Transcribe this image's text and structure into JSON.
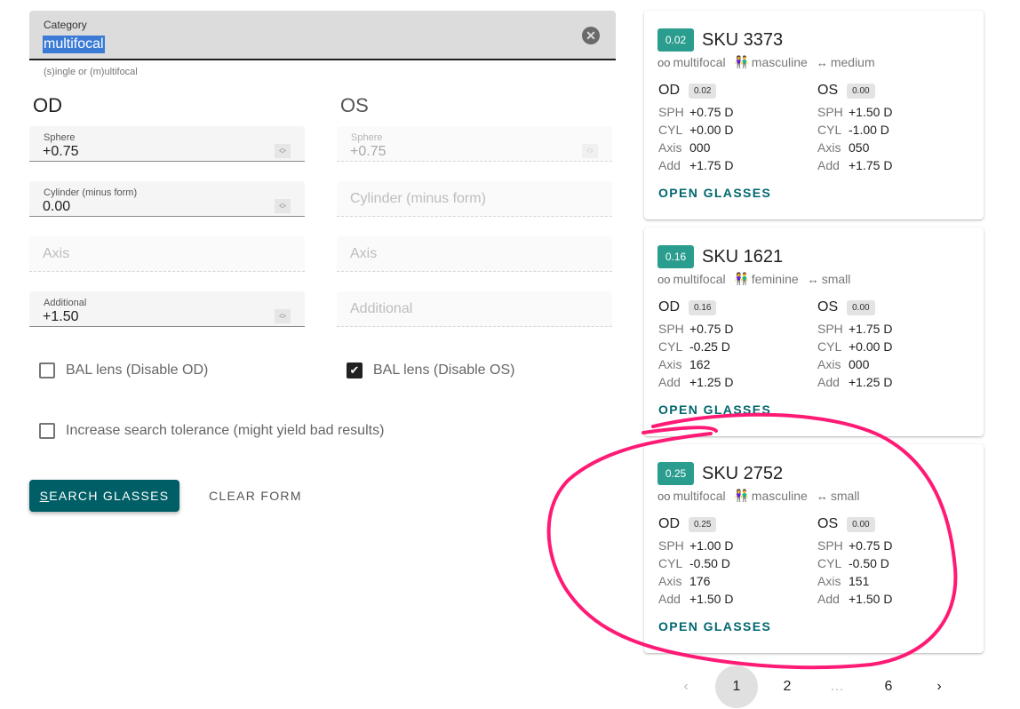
{
  "category": {
    "label": "Category",
    "value": "multifocal",
    "hint": "(s)ingle or (m)ultifocal",
    "clear_icon": "close-circle-icon"
  },
  "od": {
    "title": "OD",
    "sphere": {
      "label": "Sphere",
      "value": "+0.75"
    },
    "cylinder": {
      "label": "Cylinder (minus form)",
      "value": "0.00"
    },
    "axis": {
      "placeholder": "Axis",
      "value": ""
    },
    "additional": {
      "label": "Additional",
      "value": "+1.50"
    }
  },
  "os": {
    "title": "OS",
    "sphere": {
      "label": "Sphere",
      "value": "+0.75"
    },
    "cylinder": {
      "placeholder": "Cylinder (minus form)"
    },
    "axis": {
      "placeholder": "Axis"
    },
    "additional": {
      "placeholder": "Additional"
    }
  },
  "checkboxes": {
    "bal_od": {
      "label": "BAL lens (Disable OD)",
      "checked": false
    },
    "bal_os": {
      "label": "BAL lens (Disable OS)",
      "checked": true
    },
    "tolerance": {
      "label": "Increase search tolerance (might yield bad results)",
      "checked": false
    }
  },
  "actions": {
    "search_first": "S",
    "search_rest": "EARCH GLASSES",
    "clear": "CLEAR FORM"
  },
  "results": [
    {
      "score": "0.02",
      "sku": "SKU 3373",
      "type": "multifocal",
      "gender": "masculine",
      "size": "medium",
      "od": {
        "label": "OD",
        "score": "0.02",
        "sph": "+0.75 D",
        "cyl": "+0.00 D",
        "axis": "000",
        "add": "+1.75 D"
      },
      "os": {
        "label": "OS",
        "score": "0.00",
        "sph": "+1.50 D",
        "cyl": "-1.00 D",
        "axis": "050",
        "add": "+1.75 D"
      },
      "open": "OPEN GLASSES"
    },
    {
      "score": "0.16",
      "sku": "SKU 1621",
      "type": "multifocal",
      "gender": "feminine",
      "size": "small",
      "od": {
        "label": "OD",
        "score": "0.16",
        "sph": "+0.75 D",
        "cyl": "-0.25 D",
        "axis": "162",
        "add": "+1.25 D"
      },
      "os": {
        "label": "OS",
        "score": "0.00",
        "sph": "+1.75 D",
        "cyl": "+0.00 D",
        "axis": "000",
        "add": "+1.25 D"
      },
      "open": "OPEN GLASSES"
    },
    {
      "score": "0.25",
      "sku": "SKU 2752",
      "type": "multifocal",
      "gender": "masculine",
      "size": "small",
      "od": {
        "label": "OD",
        "score": "0.25",
        "sph": "+1.00 D",
        "cyl": "-0.50 D",
        "axis": "176",
        "add": "+1.50 D"
      },
      "os": {
        "label": "OS",
        "score": "0.00",
        "sph": "+0.75 D",
        "cyl": "-0.50 D",
        "axis": "151",
        "add": "+1.50 D"
      },
      "open": "OPEN GLASSES"
    }
  ],
  "row_labels": {
    "sph": "SPH",
    "cyl": "CYL",
    "axis": "Axis",
    "add": "Add"
  },
  "pagination": {
    "prev": "‹",
    "pages": [
      "1",
      "2",
      "…",
      "6"
    ],
    "current": "1",
    "next": "›"
  },
  "colors": {
    "primary": "#005f66",
    "score_badge": "#2a9d8f",
    "annotation": "#ff1a75"
  }
}
